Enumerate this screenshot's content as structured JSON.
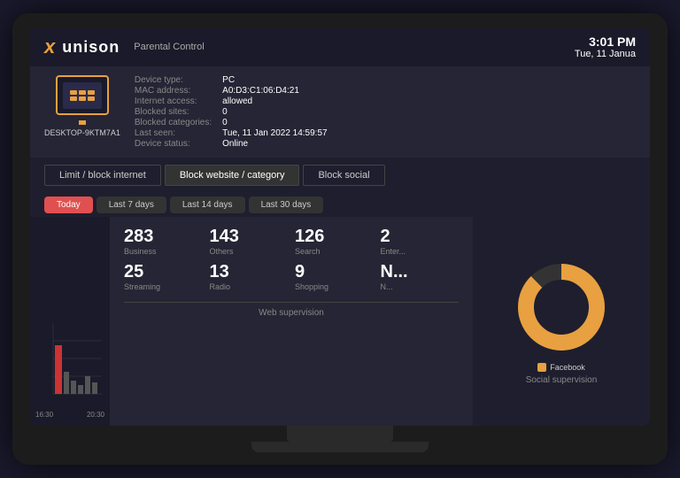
{
  "header": {
    "logo_x": "x",
    "logo_name": "unison",
    "logo_parental": "Parental Control",
    "time": "3:01 PM",
    "date": "Tue, 11 Janua"
  },
  "device": {
    "name": "DESKTOP-9KTM7A1",
    "type_label": "Device type:",
    "type_value": "PC",
    "mac_label": "MAC address:",
    "mac_value": "A0:D3:C1:06:D4:21",
    "internet_label": "Internet access:",
    "internet_value": "allowed",
    "blocked_sites_label": "Blocked sites:",
    "blocked_sites_value": "0",
    "blocked_cat_label": "Blocked categories:",
    "blocked_cat_value": "0",
    "last_seen_label": "Last seen:",
    "last_seen_value": "Tue, 11 Jan 2022 14:59:57",
    "status_label": "Device status:",
    "status_value": "Online"
  },
  "tabs": {
    "limit": "Limit / block internet",
    "block_website": "Block website / category",
    "block_social": "Block social"
  },
  "date_filters": {
    "today": "Today",
    "last7": "Last 7 days",
    "last14": "Last 14 days",
    "last30": "Last 30 days"
  },
  "stats": [
    {
      "number": "283",
      "label": "Business"
    },
    {
      "number": "143",
      "label": "Others"
    },
    {
      "number": "126",
      "label": "Search"
    },
    {
      "number": "2",
      "label": "Enter..."
    },
    {
      "number": "25",
      "label": "Streaming"
    },
    {
      "number": "13",
      "label": "Radio"
    },
    {
      "number": "9",
      "label": "Shopping"
    },
    {
      "number": "N...",
      "label": "N..."
    }
  ],
  "web_supervision": "Web supervision",
  "social_supervision": "Social supervision",
  "legend": [
    {
      "label": "Facebook",
      "color": "#e8a040"
    }
  ],
  "chart": {
    "label1": "16:30",
    "label2": "20:30"
  },
  "colors": {
    "accent": "#e8a040",
    "active_tab_bg": "#e05050",
    "donut_color": "#e8a040"
  }
}
